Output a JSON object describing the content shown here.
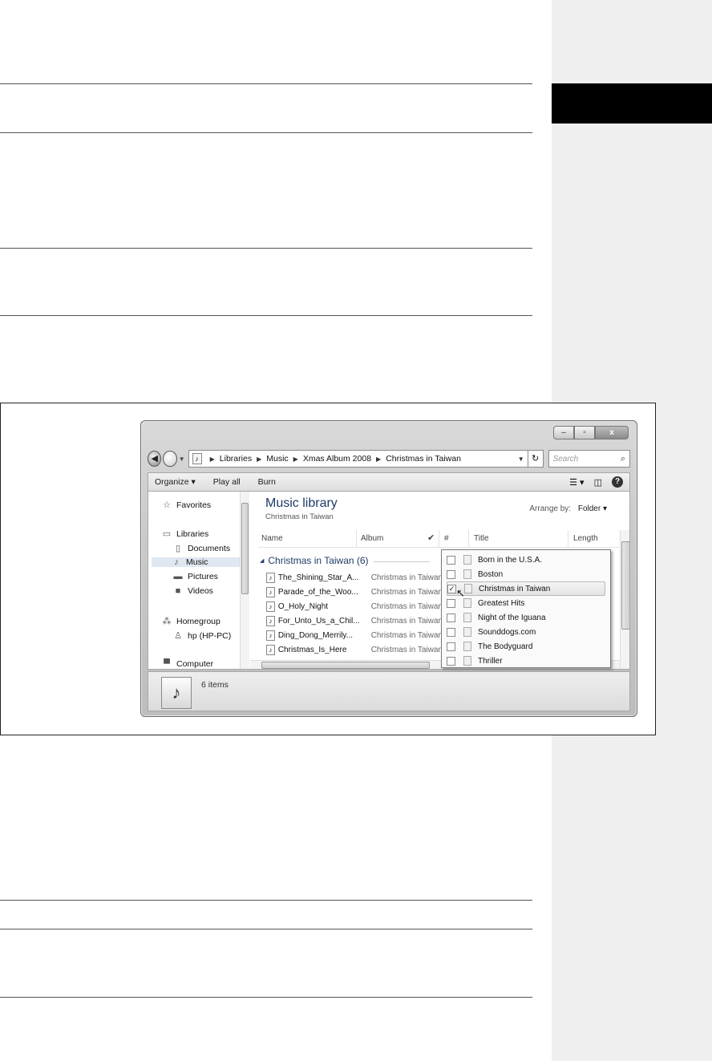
{
  "window": {
    "controls": {
      "minimize": "–",
      "maximize": "▫",
      "close": "x"
    }
  },
  "nav": {
    "back_glyph": "◀",
    "breadcrumbs": [
      "Libraries",
      "Music",
      "Xmas Album 2008",
      "Christmas in Taiwan"
    ],
    "refresh_glyph": "↻",
    "search_placeholder": "Search"
  },
  "toolbar": {
    "organize": "Organize ▾",
    "play_all": "Play all",
    "burn": "Burn",
    "help": "?"
  },
  "sidebar": {
    "items": [
      {
        "label": "Favorites",
        "icon": "star-icon"
      },
      {
        "label": "Libraries",
        "icon": "libraries-icon"
      },
      {
        "label": "Documents",
        "icon": "document-icon"
      },
      {
        "label": "Music",
        "icon": "music-icon",
        "selected": true
      },
      {
        "label": "Pictures",
        "icon": "pictures-icon"
      },
      {
        "label": "Videos",
        "icon": "videos-icon"
      },
      {
        "label": "Homegroup",
        "icon": "homegroup-icon"
      },
      {
        "label": "hp (HP-PC)",
        "icon": "user-icon"
      },
      {
        "label": "Computer",
        "icon": "computer-icon"
      }
    ]
  },
  "library": {
    "title": "Music library",
    "subtitle": "Christmas in Taiwan",
    "arrange_label": "Arrange by:",
    "arrange_value": "Folder ▾"
  },
  "columns": {
    "name": "Name",
    "album": "Album",
    "check": "✔",
    "number": "#",
    "title": "Title",
    "length": "Length"
  },
  "group": {
    "label": "Christmas in Taiwan (6)"
  },
  "files": [
    {
      "name": "The_Shining_Star_A...",
      "album": "Christmas in Taiwan"
    },
    {
      "name": "Parade_of_the_Woo...",
      "album": "Christmas in Taiwan"
    },
    {
      "name": "O_Holy_Night",
      "album": "Christmas in Taiwan"
    },
    {
      "name": "For_Unto_Us_a_Chil...",
      "album": "Christmas in Taiwan"
    },
    {
      "name": "Ding_Dong_Merrily...",
      "album": "Christmas in Taiwan"
    },
    {
      "name": "Christmas_Is_Here",
      "album": "Christmas in Taiwan"
    }
  ],
  "album_filter": [
    {
      "label": "Born in the U.S.A.",
      "checked": false
    },
    {
      "label": "Boston",
      "checked": false
    },
    {
      "label": "Christmas in Taiwan",
      "checked": true
    },
    {
      "label": "Greatest Hits",
      "checked": false
    },
    {
      "label": "Night of the Iguana",
      "checked": false
    },
    {
      "label": "Sounddogs.com",
      "checked": false
    },
    {
      "label": "The Bodyguard",
      "checked": false
    },
    {
      "label": "Thriller",
      "checked": false
    }
  ],
  "details": {
    "count": "6 items"
  }
}
